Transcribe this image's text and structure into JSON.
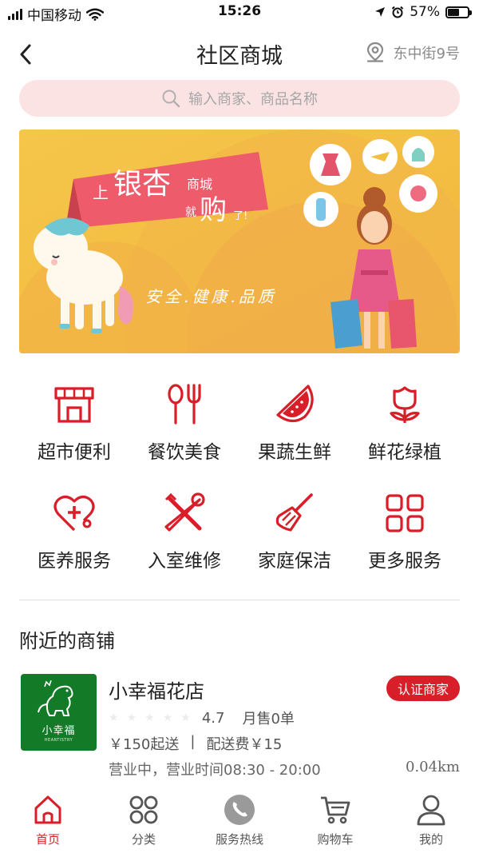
{
  "status_bar": {
    "carrier": "中国移动",
    "time": "15:26",
    "battery": "57%",
    "battery_level": 0.57
  },
  "nav": {
    "title": "社区商城",
    "location": "东中街9号"
  },
  "search": {
    "placeholder": "输入商家、商品名称"
  },
  "banner": {
    "headline_1": "上",
    "headline_2": "银杏",
    "headline_3": "商城",
    "headline_4": "就",
    "headline_5": "购",
    "headline_6": "了!",
    "tagline": "安全.健康.品质"
  },
  "categories": [
    {
      "label": "超市便利",
      "icon": "store-icon"
    },
    {
      "label": "餐饮美食",
      "icon": "fork-spoon-icon"
    },
    {
      "label": "果蔬生鲜",
      "icon": "watermelon-icon"
    },
    {
      "label": "鲜花绿植",
      "icon": "tulip-icon"
    },
    {
      "label": "医养服务",
      "icon": "medical-heart-icon"
    },
    {
      "label": "入室维修",
      "icon": "tools-icon"
    },
    {
      "label": "家庭保洁",
      "icon": "broom-icon"
    },
    {
      "label": "更多服务",
      "icon": "grid-icon"
    }
  ],
  "nearby": {
    "title": "附近的商铺",
    "shops": [
      {
        "name": "小幸福花店",
        "logo_text": "小幸福",
        "logo_subtext": "HEARTISTRY",
        "badge": "认证商家",
        "rating": "4.7",
        "stars": 5,
        "monthly_sales": "月售0单",
        "min_order": "￥150起送",
        "separator": "|",
        "delivery_fee": "配送费￥15",
        "hours": "营业中，营业时间08:30 - 20:00",
        "distance": "0.04km"
      }
    ]
  },
  "tabbar": [
    {
      "label": "首页",
      "icon": "home-icon",
      "active": true
    },
    {
      "label": "分类",
      "icon": "category-grid-icon",
      "active": false
    },
    {
      "label": "服务热线",
      "icon": "phone-icon",
      "active": false
    },
    {
      "label": "购物车",
      "icon": "cart-icon",
      "active": false
    },
    {
      "label": "我的",
      "icon": "user-icon",
      "active": false
    }
  ],
  "colors": {
    "accent": "#d81e28",
    "search_bg": "#fbe3e3",
    "logo_green": "#137a28",
    "text": "#222222",
    "muted": "#8a8a8a"
  }
}
